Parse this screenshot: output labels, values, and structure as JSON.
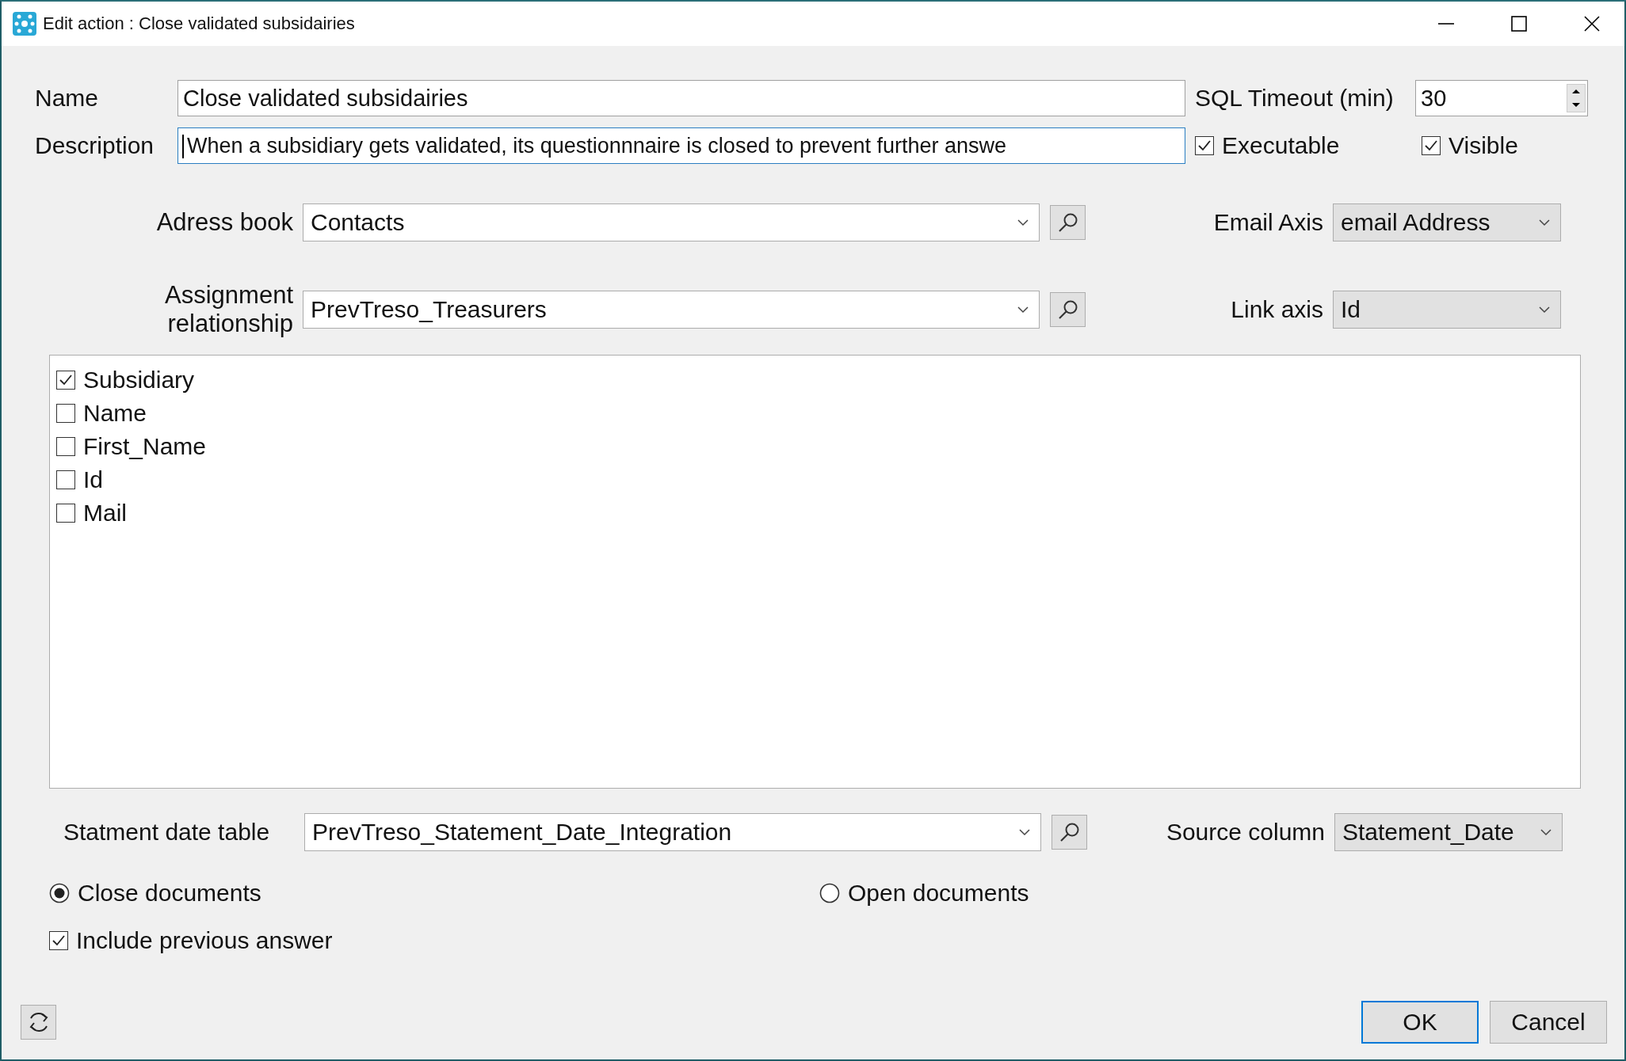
{
  "window": {
    "title": "Edit action : Close validated subsidairies"
  },
  "name": {
    "label": "Name",
    "value": "Close validated subsidairies"
  },
  "sql_timeout": {
    "label": "SQL Timeout (min)",
    "value": "30"
  },
  "description": {
    "label": "Description",
    "value": "When a subsidiary gets validated, its questionnnaire is closed to prevent further answe",
    "focused": true
  },
  "flags": [
    {
      "label": "Executable",
      "checked": true
    },
    {
      "label": "Visible",
      "checked": true
    }
  ],
  "address_book": {
    "label": "Adress book",
    "value": "Contacts",
    "editable": true
  },
  "email_axis": {
    "label": "Email Axis",
    "value": "email Address",
    "editable": false
  },
  "assignment": {
    "label": "Assignment relationship",
    "value": "PrevTreso_Treasurers",
    "editable": true
  },
  "link_axis": {
    "label": "Link axis",
    "value": "Id",
    "editable": false
  },
  "columns": [
    {
      "label": "Subsidiary",
      "checked": true
    },
    {
      "label": "Name",
      "checked": false
    },
    {
      "label": "First_Name",
      "checked": false
    },
    {
      "label": "Id",
      "checked": false
    },
    {
      "label": "Mail",
      "checked": false
    }
  ],
  "statement_table": {
    "label": "Statment date table",
    "value": "PrevTreso_Statement_Date_Integration",
    "editable": true
  },
  "source_column": {
    "label": "Source column",
    "value": "Statement_Date",
    "editable": false
  },
  "modes": [
    {
      "label": "Close documents",
      "selected": true
    },
    {
      "label": "Open documents",
      "selected": false
    }
  ],
  "include_previous": {
    "label": "Include previous answer",
    "checked": true
  },
  "buttons": [
    {
      "label": "OK",
      "default": true
    },
    {
      "label": "Cancel",
      "default": false
    }
  ]
}
